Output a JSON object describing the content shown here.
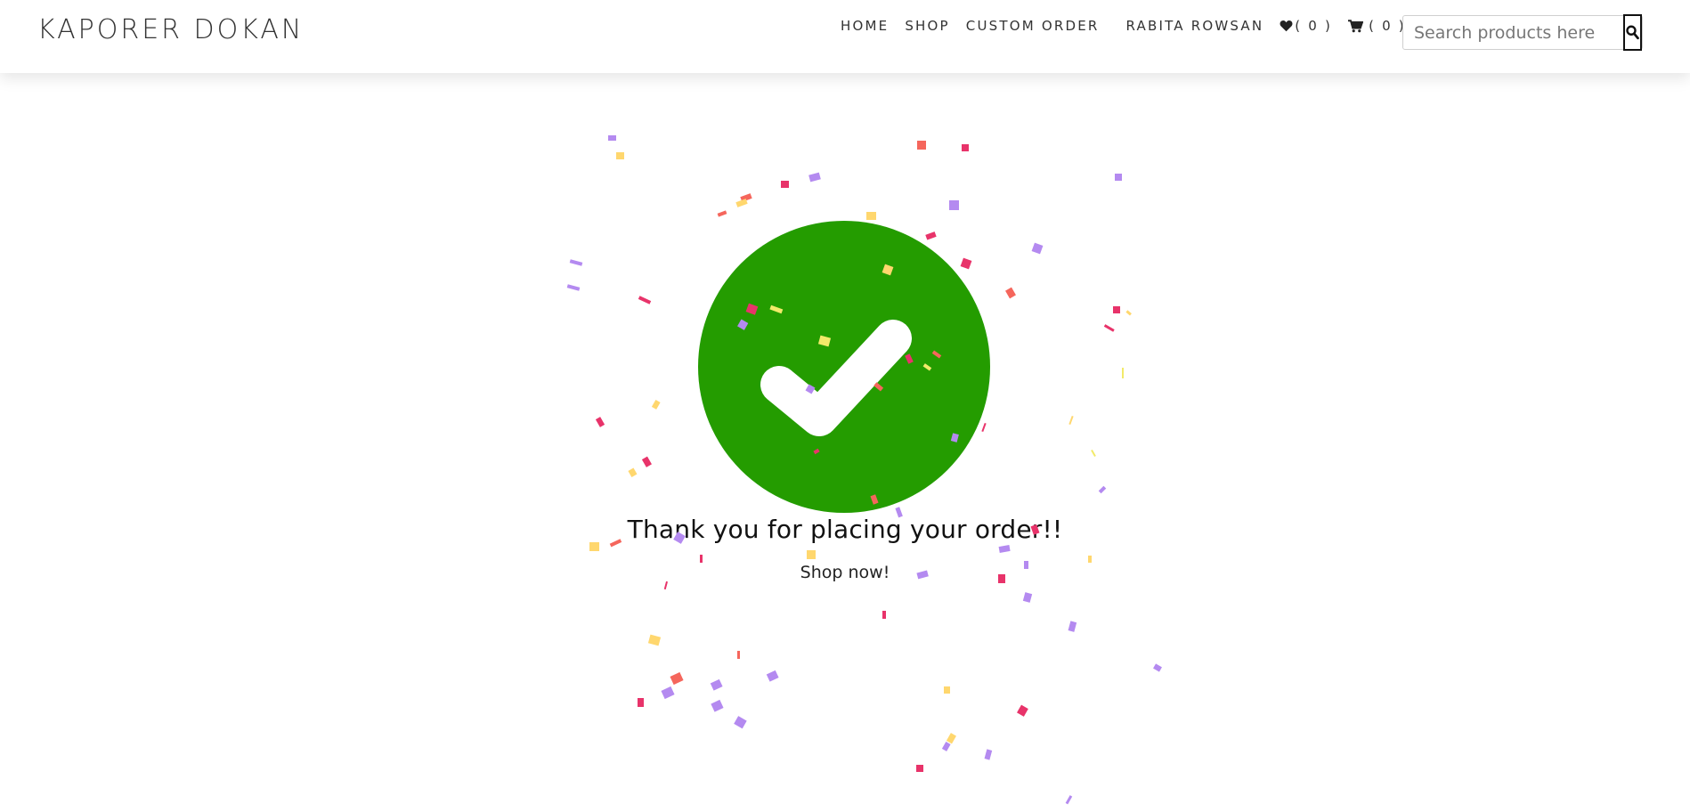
{
  "navbar": {
    "brand": "KAPORER DOKAN",
    "links": {
      "home": "HOME",
      "shop": "SHOP",
      "custom_order": "CUSTOM ORDER",
      "user": "RABITA ROWSAN"
    },
    "wishlist": {
      "icon": "heart-icon",
      "count_text": "( 0 )"
    },
    "cart": {
      "icon": "cart-icon",
      "count_text": "( 0 )"
    },
    "search": {
      "placeholder": "Search products here",
      "value": "",
      "icon": "search-icon"
    }
  },
  "main": {
    "success_icon": "check-circle-icon",
    "success_color": "#249c00",
    "message": "Thank you for placing your order!!",
    "shop_link": "Shop now!"
  },
  "confetti_colors": [
    "#b48af0",
    "#ffd76e",
    "#e8336a",
    "#f5665c",
    "#f2ea6a"
  ]
}
